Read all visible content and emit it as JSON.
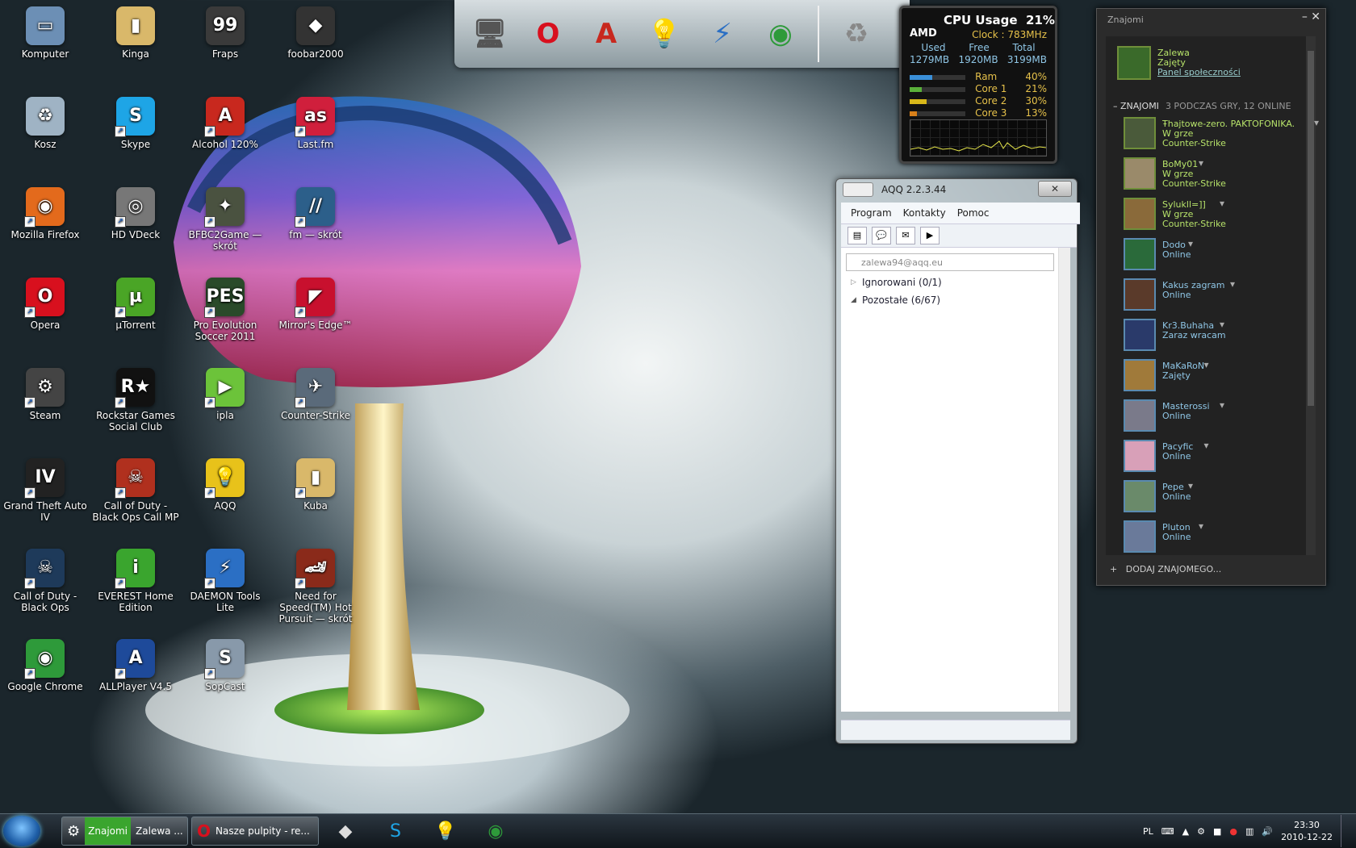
{
  "desktop_icons": [
    {
      "label": "Komputer",
      "icon": "computer-icon",
      "color": "#6c8fb5",
      "glyph": "▭"
    },
    {
      "label": "Kinga",
      "icon": "folder-icon",
      "color": "#d9b86a",
      "glyph": "▮"
    },
    {
      "label": "Fraps",
      "icon": "fraps-icon",
      "color": "#3a3a3a",
      "glyph": "99"
    },
    {
      "label": "foobar2000",
      "icon": "foobar-icon",
      "color": "#333333",
      "glyph": "◆"
    },
    {
      "label": "Kosz",
      "icon": "recycle-bin-icon",
      "color": "#9fb3c4",
      "glyph": "♻"
    },
    {
      "label": "Skype",
      "icon": "skype-icon",
      "color": "#1ea5e6",
      "glyph": "S"
    },
    {
      "label": "Alcohol 120%",
      "icon": "alcohol-icon",
      "color": "#c8281e",
      "glyph": "A"
    },
    {
      "label": "Last.fm",
      "icon": "lastfm-icon",
      "color": "#d01f3c",
      "glyph": "as"
    },
    {
      "label": "Mozilla Firefox",
      "icon": "firefox-icon",
      "color": "#e36a1c",
      "glyph": "◉"
    },
    {
      "label": "HD VDeck",
      "icon": "hdvdeck-icon",
      "color": "#777777",
      "glyph": "◎"
    },
    {
      "label": "BFBC2Game — skrót",
      "icon": "bfbc2-icon",
      "color": "#4a5240",
      "glyph": "✦"
    },
    {
      "label": "fm — skrót",
      "icon": "fm-icon",
      "color": "#2c5f8a",
      "glyph": "//"
    },
    {
      "label": "Opera",
      "icon": "opera-icon",
      "color": "#d8101e",
      "glyph": "O"
    },
    {
      "label": "µTorrent",
      "icon": "utorrent-icon",
      "color": "#4aa526",
      "glyph": "µ"
    },
    {
      "label": "Pro Evolution Soccer 2011",
      "icon": "pes-icon",
      "color": "#2a4a2a",
      "glyph": "PES"
    },
    {
      "label": "Mirror's Edge™",
      "icon": "mirrors-edge-icon",
      "color": "#c8102e",
      "glyph": "◤"
    },
    {
      "label": "Steam",
      "icon": "steam-icon",
      "color": "#444444",
      "glyph": "⚙"
    },
    {
      "label": "Rockstar Games Social Club",
      "icon": "rockstar-icon",
      "color": "#111111",
      "glyph": "R★"
    },
    {
      "label": "ipla",
      "icon": "ipla-icon",
      "color": "#6cc33a",
      "glyph": "▶"
    },
    {
      "label": "Counter-Strike",
      "icon": "counter-strike-icon",
      "color": "#5a6a7a",
      "glyph": "✈"
    },
    {
      "label": "Grand Theft Auto IV",
      "icon": "gta-icon",
      "color": "#222222",
      "glyph": "IV"
    },
    {
      "label": "Call of Duty - Black Ops Call MP",
      "icon": "cod-mp-icon",
      "color": "#b0301e",
      "glyph": "☠"
    },
    {
      "label": "AQQ",
      "icon": "aqq-icon",
      "color": "#e8c21a",
      "glyph": "💡"
    },
    {
      "label": "Kuba",
      "icon": "folder-icon",
      "color": "#d9b86a",
      "glyph": "▮"
    },
    {
      "label": "Call of Duty - Black Ops",
      "icon": "cod-icon",
      "color": "#1e3a5a",
      "glyph": "☠"
    },
    {
      "label": "EVEREST Home Edition",
      "icon": "everest-icon",
      "color": "#3aa52e",
      "glyph": "i"
    },
    {
      "label": "DAEMON Tools Lite",
      "icon": "daemon-tools-icon",
      "color": "#2b6fc4",
      "glyph": "⚡"
    },
    {
      "label": "Need for Speed(TM) Hot Pursuit — skrót",
      "icon": "nfs-icon",
      "color": "#8a2a1a",
      "glyph": "🏎"
    },
    {
      "label": "Google Chrome",
      "icon": "chrome-icon",
      "color": "#2e9a3a",
      "glyph": "◉"
    },
    {
      "label": "ALLPlayer V4.5",
      "icon": "allplayer-icon",
      "color": "#1e4a9a",
      "glyph": "A"
    },
    {
      "label": "SopCast",
      "icon": "sopcast-icon",
      "color": "#8899aa",
      "glyph": "S"
    }
  ],
  "dock": {
    "items": [
      {
        "icon": "monitor-icon",
        "glyph": "🖥",
        "color": "#555555"
      },
      {
        "icon": "opera-icon",
        "glyph": "O",
        "color": "#d8101e"
      },
      {
        "icon": "alcohol-icon",
        "glyph": "A",
        "color": "#c8281e"
      },
      {
        "icon": "aqq-icon",
        "glyph": "💡",
        "color": "#e8c21a"
      },
      {
        "icon": "daemon-tools-icon",
        "glyph": "⚡",
        "color": "#2b6fc4"
      },
      {
        "icon": "chrome-icon",
        "glyph": "◉",
        "color": "#2e9a3a"
      }
    ],
    "bin_icon": "recycle-bin-icon",
    "bin_glyph": "♻"
  },
  "cpu": {
    "title": "CPU Usage",
    "total": "21%",
    "brand": "AMD",
    "clock_label": "Clock :",
    "clock_value": "783MHz",
    "used_label": "Used",
    "free_label": "Free",
    "total_label": "Total",
    "used": "1279MB",
    "free": "1920MB",
    "total_mem": "3199MB",
    "meters": [
      {
        "label": "Ram",
        "pct": "40%",
        "value": 0.4,
        "color": "#3a8fd8"
      },
      {
        "label": "Core 1",
        "pct": "21%",
        "value": 0.21,
        "color": "#5ab03a"
      },
      {
        "label": "Core 2",
        "pct": "30%",
        "value": 0.3,
        "color": "#d8b81a"
      },
      {
        "label": "Core 3",
        "pct": "13%",
        "value": 0.13,
        "color": "#d8801a"
      }
    ]
  },
  "aqq": {
    "title": "AQQ 2.2.3.44",
    "close": "✕",
    "menu": [
      "Program",
      "Kontakty",
      "Pomoc"
    ],
    "search_placeholder": "zalewa94@aqq.eu",
    "groups": [
      {
        "label": "Ignorowani (0/1)",
        "arrow": "▷"
      },
      {
        "label": "Pozostałe (6/67)",
        "arrow": "◢"
      }
    ]
  },
  "friends": {
    "title": "Znajomi",
    "min": "–",
    "close": "✕",
    "me": {
      "name": "Zalewa",
      "status": "Zajęty",
      "link": "Panel społeczności",
      "color": "#3a6a2a"
    },
    "header": {
      "label": "ZNAJOMI",
      "sub": "3 PODCZAS GRY, 12 ONLINE"
    },
    "list": [
      {
        "name": "Ŧhajtowe-zero.  PAKTOFONIKA.",
        "status": "W grze",
        "game": "Counter-Strike",
        "ingame": true,
        "color": "#4a5a3a"
      },
      {
        "name": "BoMy01",
        "status": "W grze",
        "game": "Counter-Strike",
        "ingame": true,
        "color": "#9a8a6a"
      },
      {
        "name": "Sylukll=]]",
        "status": "W grze",
        "game": "Counter-Strike",
        "ingame": true,
        "color": "#8a6a3a"
      },
      {
        "name": "Dodo",
        "status": "Online",
        "ingame": false,
        "color": "#2a6a3a"
      },
      {
        "name": "Kakus zagram",
        "status": "Online",
        "ingame": false,
        "color": "#5a3a2a"
      },
      {
        "name": "Kr3.Buhaha",
        "status": "Zaraz wracam",
        "ingame": false,
        "color": "#2a3a6a"
      },
      {
        "name": "MaKaRoN",
        "status": "Zajęty",
        "ingame": false,
        "color": "#a07a3a"
      },
      {
        "name": "Masterossi",
        "status": "Online",
        "ingame": false,
        "color": "#7a7a8a"
      },
      {
        "name": "Pacyfic",
        "status": "Online",
        "ingame": false,
        "color": "#d8a0b8"
      },
      {
        "name": "Pepe",
        "status": "Online",
        "ingame": false,
        "color": "#6a8a6a"
      },
      {
        "name": "Pluton",
        "status": "Online",
        "ingame": false,
        "color": "#6a7a9a"
      }
    ],
    "add": "DODAJ ZNAJOMEGO..."
  },
  "taskbar": {
    "buttons": [
      {
        "label_green": "Znajomi",
        "label": "Zalewa ...",
        "icon": "steam-icon"
      },
      {
        "label": "Nasze pulpity - re...",
        "icon": "opera-icon"
      }
    ],
    "pinned": [
      {
        "icon": "foobar-icon",
        "glyph": "◆"
      },
      {
        "icon": "skype-icon",
        "glyph": "S"
      },
      {
        "icon": "aqq-icon",
        "glyph": "💡"
      },
      {
        "icon": "chrome-icon",
        "glyph": "◉"
      }
    ],
    "lang": "PL",
    "time": "23:30",
    "date": "2010-12-22"
  }
}
